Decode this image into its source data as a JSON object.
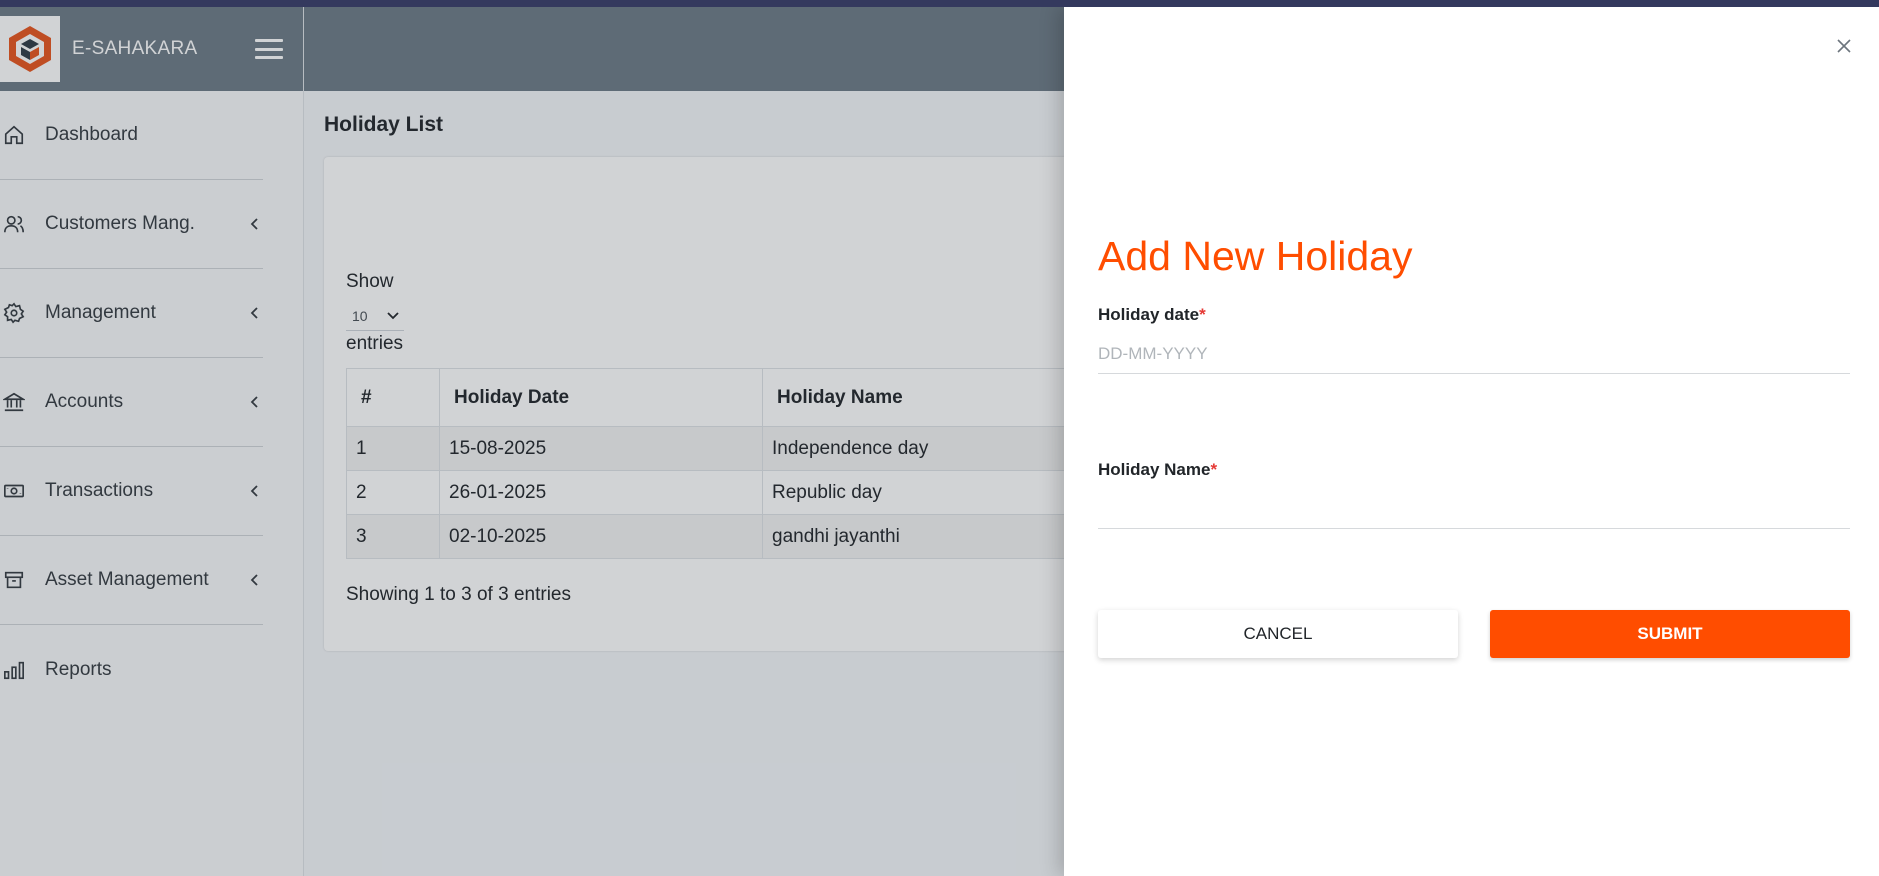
{
  "app": {
    "name": "E-SAHAKARA"
  },
  "sidebar": {
    "items": [
      {
        "label": "Dashboard",
        "icon": "home-icon",
        "has_submenu": false
      },
      {
        "label": "Customers Mang.",
        "icon": "users-icon",
        "has_submenu": true
      },
      {
        "label": "Management",
        "icon": "gear-icon",
        "has_submenu": true
      },
      {
        "label": "Accounts",
        "icon": "bank-icon",
        "has_submenu": true
      },
      {
        "label": "Transactions",
        "icon": "cash-icon",
        "has_submenu": true
      },
      {
        "label": "Asset Management",
        "icon": "archive-icon",
        "has_submenu": true
      },
      {
        "label": "Reports",
        "icon": "bar-chart-icon",
        "has_submenu": false
      }
    ]
  },
  "page": {
    "title": "Holiday List",
    "show_label": "Show",
    "page_size": "10",
    "entries_label": "entries",
    "table": {
      "headers": [
        "#",
        "Holiday Date",
        "Holiday Name"
      ],
      "rows": [
        [
          "1",
          "15-08-2025",
          "Independence day"
        ],
        [
          "2",
          "26-01-2025",
          "Republic day"
        ],
        [
          "3",
          "02-10-2025",
          "gandhi jayanthi"
        ]
      ]
    },
    "showing_text": "Showing 1 to 3 of 3 entries"
  },
  "drawer": {
    "title": "Add New Holiday",
    "date_label": "Holiday date",
    "date_placeholder": "DD-MM-YYYY",
    "date_value": "",
    "name_label": "Holiday Name",
    "name_value": "",
    "required_mark": "*",
    "cancel_label": "CANCEL",
    "submit_label": "SUBMIT"
  },
  "colors": {
    "accent": "#ff4d00",
    "header": "#6c7a86",
    "required": "#e53935"
  }
}
